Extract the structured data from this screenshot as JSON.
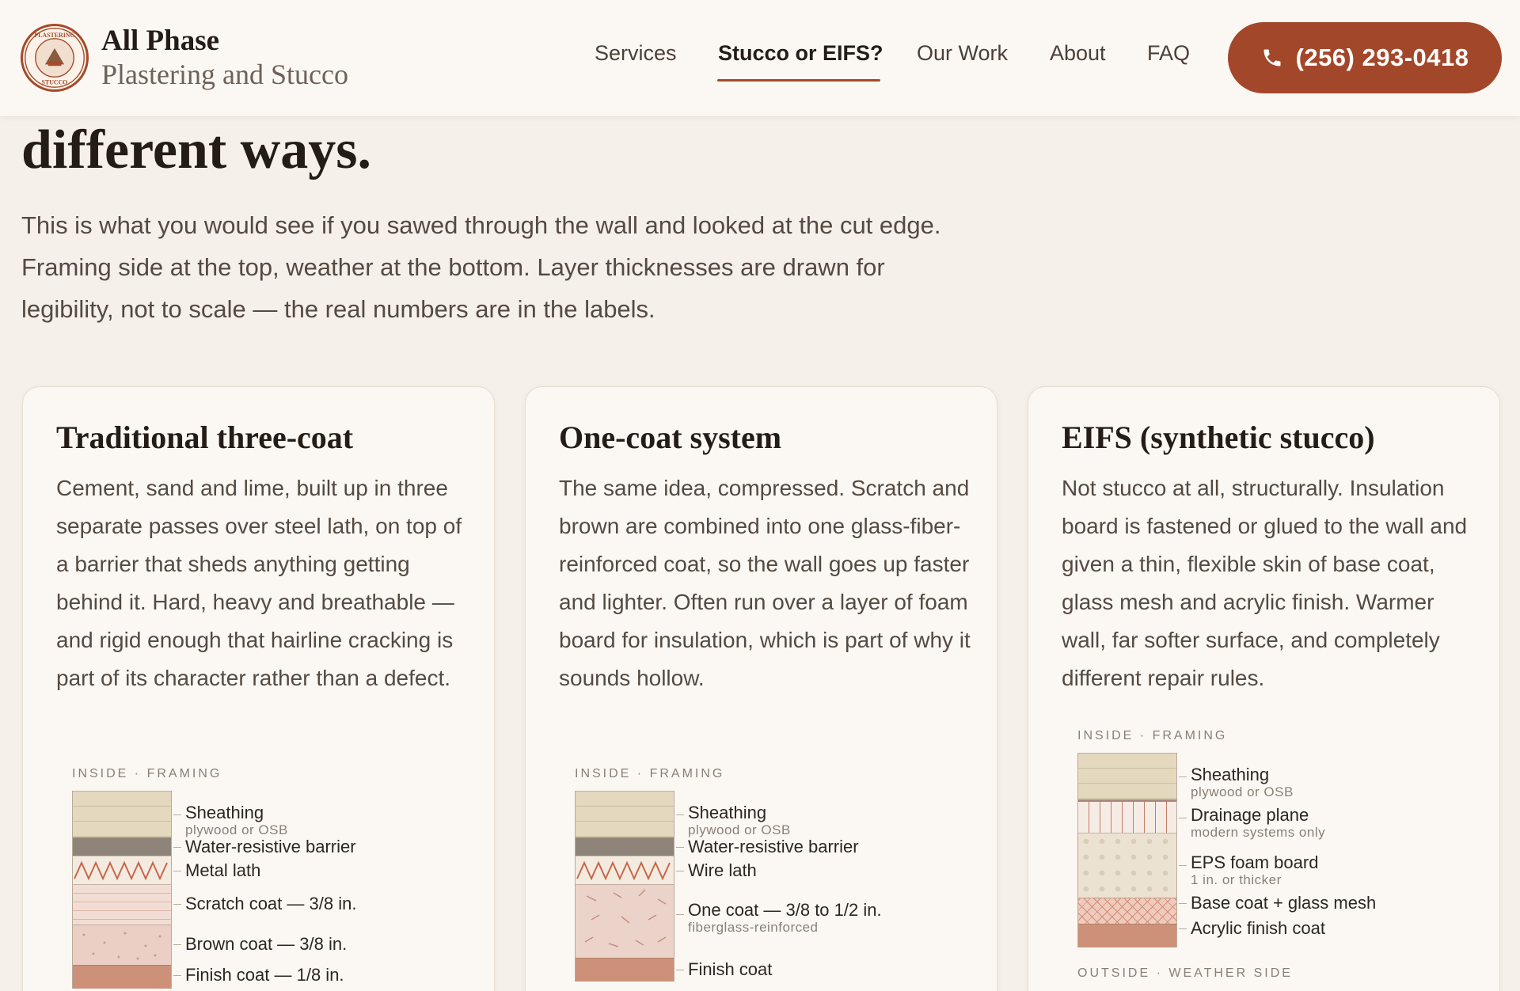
{
  "header": {
    "brand_name": "All Phase",
    "brand_sub": "Plastering and Stucco",
    "logo_text_top": "PLASTERING",
    "logo_text_bottom": "STUCCO",
    "nav": [
      "Services",
      "Stucco or EIFS?",
      "Our Work",
      "About",
      "FAQ"
    ],
    "active_nav": "Stucco or EIFS?",
    "phone": "(256) 293-0418"
  },
  "hero": {
    "title": "different ways.",
    "body": "This is what you would see if you sawed through the wall and looked at the cut edge. Framing side at the top, weather at the bottom. Layer thicknesses are drawn for legibility, not to scale — the real numbers are in the labels."
  },
  "cards": [
    {
      "title": "Traditional three-coat",
      "body": "Cement, sand and lime, built up in three separate passes over steel lath, on top of a barrier that sheds anything getting behind it. Hard, heavy and breathable — and rigid enough that hairline cracking is part of its character rather than a defect.",
      "top_caption": "INSIDE · FRAMING",
      "layers": [
        {
          "label": "Sheathing",
          "sub": "plywood or OSB"
        },
        {
          "label": "Water-resistive barrier",
          "sub": ""
        },
        {
          "label": "Metal lath",
          "sub": ""
        },
        {
          "label": "Scratch coat — 3/8 in.",
          "sub": ""
        },
        {
          "label": "Brown coat — 3/8 in.",
          "sub": ""
        },
        {
          "label": "Finish coat — 1/8 in.",
          "sub": ""
        }
      ]
    },
    {
      "title": "One-coat system",
      "body": "The same idea, compressed. Scratch and brown are combined into one glass-fiber-reinforced coat, so the wall goes up faster and lighter. Often run over a layer of foam board for insulation, which is part of why it sounds hollow.",
      "top_caption": "INSIDE · FRAMING",
      "layers": [
        {
          "label": "Sheathing",
          "sub": "plywood or OSB"
        },
        {
          "label": "Water-resistive barrier",
          "sub": ""
        },
        {
          "label": "Wire lath",
          "sub": ""
        },
        {
          "label": "One coat — 3/8 to 1/2 in.",
          "sub": "fiberglass-reinforced"
        },
        {
          "label": "Finish coat",
          "sub": ""
        }
      ]
    },
    {
      "title": "EIFS (synthetic stucco)",
      "body": "Not stucco at all, structurally. Insulation board is fastened or glued to the wall and given a thin, flexible skin of base coat, glass mesh and acrylic finish. Warmer wall, far softer surface, and completely different repair rules.",
      "top_caption": "INSIDE · FRAMING",
      "bottom_caption": "OUTSIDE · WEATHER SIDE",
      "layers": [
        {
          "label": "Sheathing",
          "sub": "plywood or OSB"
        },
        {
          "label": "Drainage plane",
          "sub": "modern systems only"
        },
        {
          "label": "EPS foam board",
          "sub": "1 in. or thicker"
        },
        {
          "label": "Base coat + glass mesh",
          "sub": ""
        },
        {
          "label": "Acrylic finish coat",
          "sub": ""
        }
      ]
    }
  ],
  "colors": {
    "accent": "#a3472a",
    "background": "#f5f0e9",
    "card": "#fbf8f3"
  }
}
